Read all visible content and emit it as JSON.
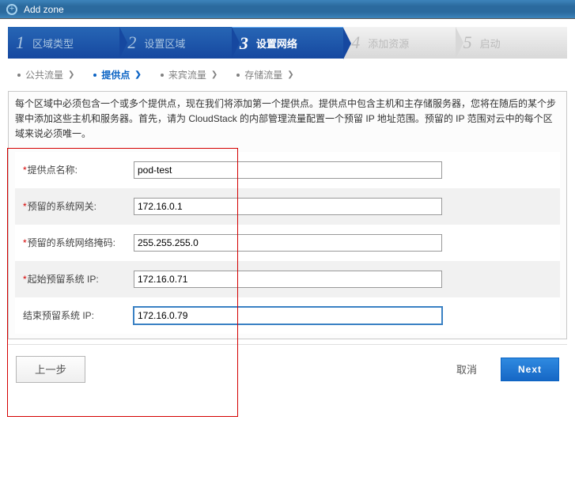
{
  "titlebar": {
    "title": "Add zone"
  },
  "steps": [
    {
      "num": "1",
      "label": "区域类型"
    },
    {
      "num": "2",
      "label": "设置区域"
    },
    {
      "num": "3",
      "label": "设置网络"
    },
    {
      "num": "4",
      "label": "添加资源"
    },
    {
      "num": "5",
      "label": "启动"
    }
  ],
  "substeps": [
    {
      "label": "公共流量"
    },
    {
      "label": "提供点"
    },
    {
      "label": "来宾流量"
    },
    {
      "label": "存储流量"
    }
  ],
  "description": "每个区域中必须包含一个或多个提供点，现在我们将添加第一个提供点。提供点中包含主机和主存储服务器，您将在随后的某个步骤中添加这些主机和服务器。首先，请为 CloudStack 的内部管理流量配置一个预留 IP 地址范围。预留的 IP 范围对云中的每个区域来说必须唯一。",
  "form": {
    "pod_name": {
      "label": "提供点名称:",
      "value": "pod-test"
    },
    "gateway": {
      "label": "预留的系统网关:",
      "value": "172.16.0.1"
    },
    "netmask": {
      "label": "预留的系统网络掩码:",
      "value": "255.255.255.0"
    },
    "start_ip": {
      "label": "起始预留系统 IP:",
      "value": "172.16.0.71"
    },
    "end_ip": {
      "label": "结束预留系统 IP:",
      "value": "172.16.0.79"
    }
  },
  "footer": {
    "prev": "上一步",
    "cancel": "取消",
    "next": "Next"
  }
}
